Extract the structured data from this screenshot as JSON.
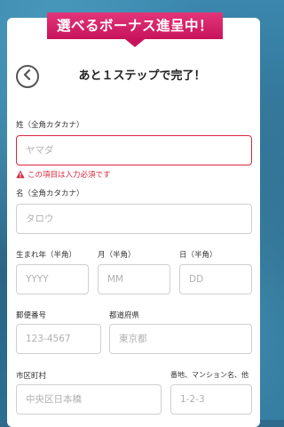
{
  "banner": {
    "text": "選べるボーナス進呈中！"
  },
  "header": {
    "title": "あと１ステップで完了！",
    "back_icon": "chevron-left-icon"
  },
  "form": {
    "last_name": {
      "label": "姓（全角カタカナ）",
      "placeholder": "ヤマダ",
      "value": "",
      "error": "この項目は入力必須です",
      "state": "error"
    },
    "first_name": {
      "label": "名（全角カタカナ）",
      "placeholder": "タロウ",
      "value": ""
    },
    "birth_year": {
      "label": "生まれ年（半角）",
      "placeholder": "YYYY",
      "value": ""
    },
    "birth_month": {
      "label": "月（半角）",
      "placeholder": "MM",
      "value": ""
    },
    "birth_day": {
      "label": "日（半角）",
      "placeholder": "DD",
      "value": ""
    },
    "postal_code": {
      "label": "郵便番号",
      "placeholder": "123-4567",
      "value": ""
    },
    "prefecture": {
      "label": "都道府県",
      "placeholder": "東京都",
      "value": ""
    },
    "city": {
      "label": "市区町村",
      "placeholder": "中央区日本橋",
      "value": ""
    },
    "address": {
      "label": "番地、マンション名、他",
      "placeholder": "1-2-3",
      "value": ""
    }
  },
  "colors": {
    "banner": "#d3206a",
    "error": "#d8283c",
    "background": "#2d6a8c"
  }
}
